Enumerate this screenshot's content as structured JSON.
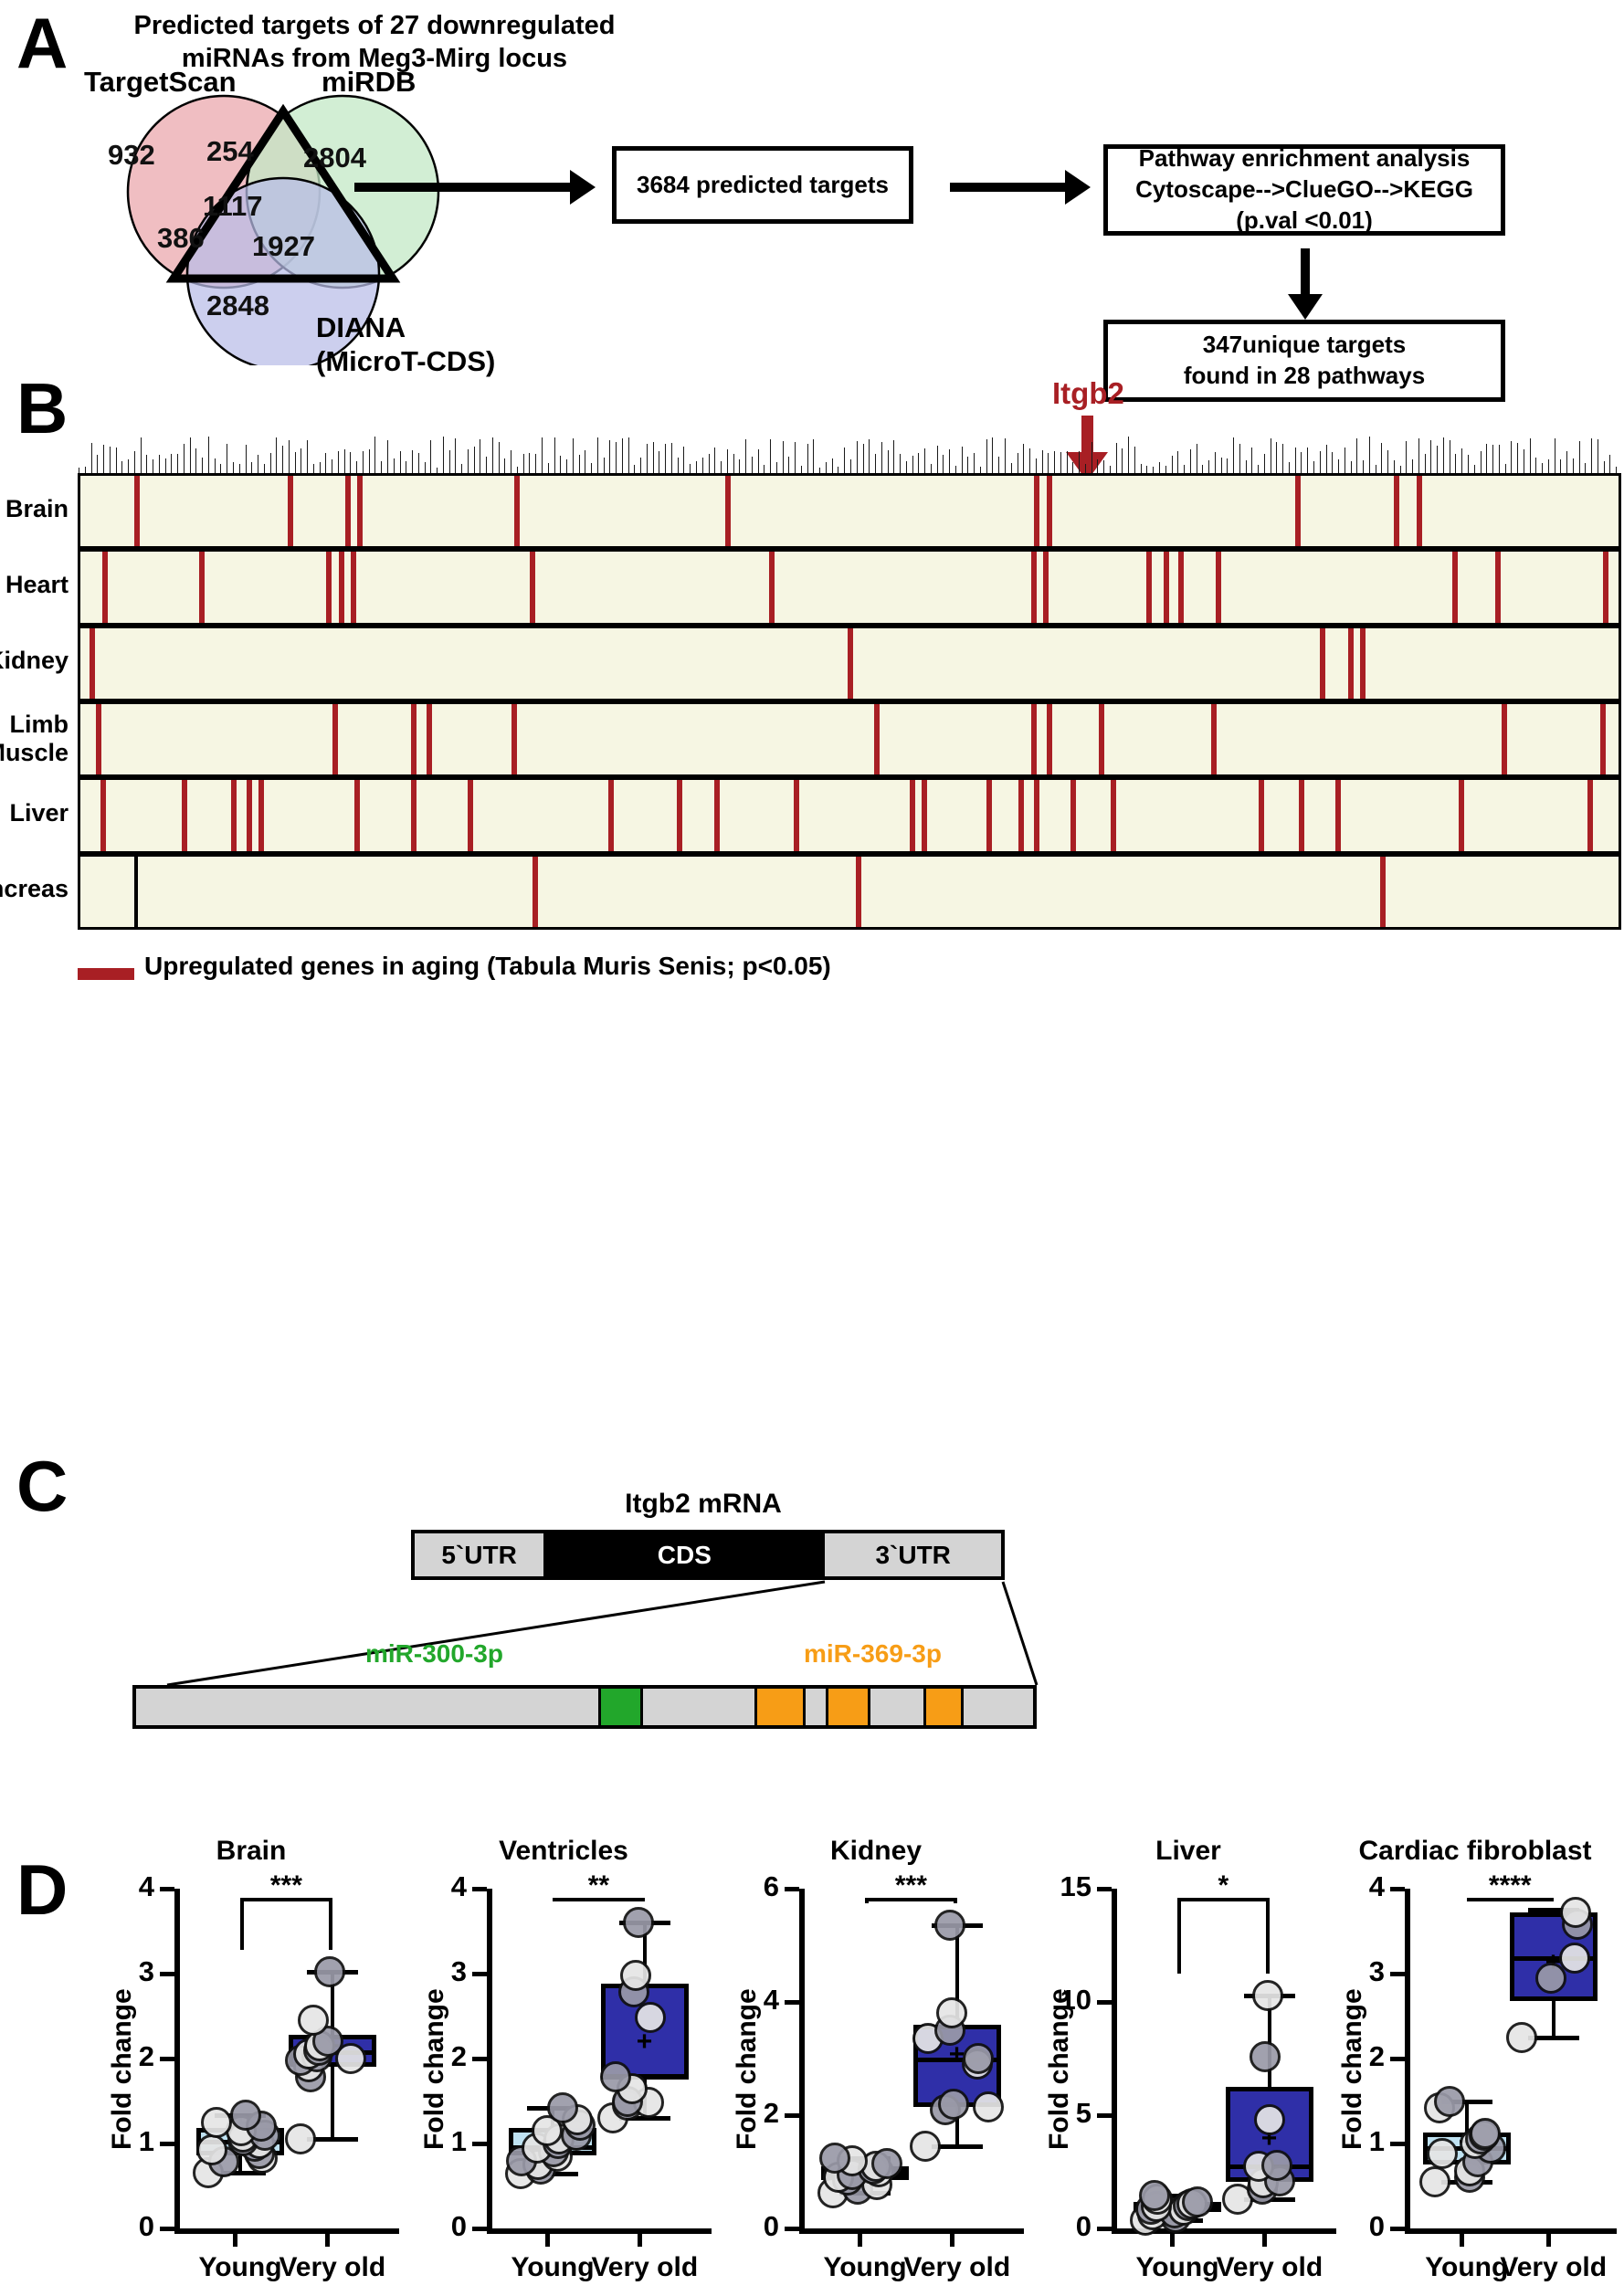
{
  "panelA": {
    "letter": "A",
    "title": "Predicted targets of 27 downregulated\nmiRNAs from Meg3-Mirg locus",
    "venn": {
      "sets": [
        {
          "name": "TargetScan",
          "color": "#efb8bd",
          "unique": "932"
        },
        {
          "name": "miRDB",
          "color": "#c3e8c6",
          "unique": "2804"
        },
        {
          "name": "DIANA\n(MicroT-CDS)",
          "color": "#b9bce8",
          "unique": "2848"
        }
      ],
      "overlaps": [
        {
          "label": "254",
          "sets": "TargetScan+miRDB"
        },
        {
          "label": "1117",
          "sets": "TargetScan+miRDB+DIANA"
        },
        {
          "label": "386",
          "sets": "TargetScan+DIANA"
        },
        {
          "label": "1927",
          "sets": "miRDB+DIANA"
        }
      ]
    },
    "box_targets": "3684 predicted targets",
    "box_pathway": "Pathway enrichment analysis\nCytoscape-->ClueGO-->KEGG\n(p.val <0.01)",
    "box_unique": "347unique targets\nfound in 28 pathways"
  },
  "panelB": {
    "letter": "B",
    "highlight_gene": "Itgb2",
    "tissues": [
      "Brain",
      "Heart",
      "Kidney",
      "Limb\nMuscle",
      "Liver",
      "Pancreas"
    ],
    "legend": "Upregulated genes in aging (Tabula Muris Senis; p<0.05)",
    "legend_color": "#a81f24",
    "grid_color": "#f6f6e3",
    "upregulated_positions": {
      "Brain": [
        3.5,
        13.5,
        17.2,
        18.0,
        28.2,
        41.9,
        62.0,
        62.8,
        79.0,
        85.4,
        86.9
      ],
      "Heart": [
        1.4,
        7.7,
        16.0,
        16.8,
        17.6,
        29.2,
        44.8,
        61.8,
        62.6,
        69.3,
        70.4,
        71.4,
        73.8,
        89.2,
        92.0,
        99.0
      ],
      "Kidney": [
        0.6,
        49.9,
        80.6,
        82.4,
        83.2
      ],
      "Limb\nMuscle": [
        1.0,
        16.4,
        21.5,
        22.5,
        28.0,
        51.6,
        61.8,
        62.8,
        66.2,
        73.5,
        92.4,
        98.8
      ],
      "Liver": [
        1.3,
        6.6,
        9.8,
        10.8,
        11.6,
        17.8,
        21.5,
        25.2,
        34.3,
        38.8,
        41.2,
        46.4,
        53.9,
        54.7,
        58.9,
        61.0,
        62.0,
        64.4,
        67.0,
        76.6,
        79.2,
        81.6,
        89.6,
        98.0
      ],
      "Pancreas": [
        29.4,
        50.4,
        84.5
      ]
    },
    "black_positions": {
      "Pancreas": [
        3.5
      ]
    }
  },
  "panelC": {
    "letter": "C",
    "mrna_title": "Itgb2 mRNA",
    "segments": [
      {
        "label": "5`UTR",
        "fill": "#d4d4d4",
        "text_color": "#000000"
      },
      {
        "label": "CDS",
        "fill": "#000000",
        "text_color": "#ffffff"
      },
      {
        "label": "3`UTR",
        "fill": "#d4d4d4",
        "text_color": "#000000"
      }
    ],
    "mir_sites": [
      {
        "name": "miR-300-3p",
        "color": "#22a72b"
      },
      {
        "name": "miR-369-3p",
        "color": "#f79d16"
      }
    ],
    "utr_track": [
      {
        "start": 0.0,
        "width": 51.5,
        "color": "#d4d4d4"
      },
      {
        "start": 51.5,
        "width": 5.0,
        "color": "#22a72b"
      },
      {
        "start": 56.5,
        "width": 12.4,
        "color": "#d4d4d4"
      },
      {
        "start": 68.9,
        "width": 5.7,
        "color": "#f79d16"
      },
      {
        "start": 74.6,
        "width": 2.3,
        "color": "#d4d4d4"
      },
      {
        "start": 76.9,
        "width": 5.0,
        "color": "#f79d16"
      },
      {
        "start": 81.9,
        "width": 5.9,
        "color": "#d4d4d4"
      },
      {
        "start": 87.8,
        "width": 4.5,
        "color": "#f79d16"
      },
      {
        "start": 92.3,
        "width": 7.7,
        "color": "#d4d4d4"
      }
    ]
  },
  "panelD": {
    "letter": "D",
    "ylabel": "Fold change",
    "xlabels": [
      "Young",
      "Very old"
    ],
    "colors": {
      "young_box": "#bfe2f2",
      "old_box": "#2f2fa8",
      "dot_fill": "#d9d9d9"
    }
  },
  "chart_data": [
    {
      "type": "box",
      "title": "Brain",
      "ylabel": "Fold change",
      "xlabel": "",
      "ylim": [
        0,
        4
      ],
      "yticks": [
        0,
        1,
        2,
        3,
        4
      ],
      "categories": [
        "Young",
        "Very old"
      ],
      "significance": "***",
      "series": [
        {
          "name": "Young",
          "box_color": "#bfe2f2",
          "min": 0.66,
          "q1": 0.86,
          "median": 1.02,
          "q3": 1.18,
          "max": 1.33,
          "mean": 1.0,
          "points": [
            0.66,
            0.78,
            0.83,
            0.88,
            0.93,
            0.97,
            1.0,
            1.03,
            1.07,
            1.1,
            1.15,
            1.2,
            1.25,
            1.33
          ]
        },
        {
          "name": "Very old",
          "box_color": "#2f2fa8",
          "min": 1.05,
          "q1": 1.9,
          "median": 2.07,
          "q3": 2.28,
          "max": 3.02,
          "mean": 2.13,
          "points": [
            1.05,
            1.78,
            1.9,
            1.98,
            2.0,
            2.02,
            2.05,
            2.1,
            2.15,
            2.2,
            2.45,
            3.02
          ]
        }
      ]
    },
    {
      "type": "box",
      "title": "Ventricles",
      "ylabel": "Fold change",
      "xlabel": "",
      "ylim": [
        0,
        4
      ],
      "yticks": [
        0,
        1,
        2,
        3,
        4
      ],
      "categories": [
        "Young",
        "Very old"
      ],
      "significance": "**",
      "series": [
        {
          "name": "Young",
          "box_color": "#bfe2f2",
          "min": 0.65,
          "q1": 0.86,
          "median": 0.96,
          "q3": 1.18,
          "max": 1.42,
          "mean": 1.02,
          "points": [
            0.65,
            0.7,
            0.75,
            0.8,
            0.85,
            0.9,
            0.95,
            1.0,
            1.05,
            1.1,
            1.15,
            1.22,
            1.28,
            1.42
          ]
        },
        {
          "name": "Very old",
          "box_color": "#2f2fa8",
          "min": 1.3,
          "q1": 1.75,
          "median": 1.8,
          "q3": 2.88,
          "max": 3.6,
          "mean": 2.18,
          "points": [
            1.3,
            1.45,
            1.48,
            1.5,
            1.65,
            1.78,
            2.48,
            2.78,
            2.98,
            3.6
          ]
        }
      ]
    },
    {
      "type": "box",
      "title": "Kidney",
      "ylabel": "Fold change",
      "xlabel": "",
      "ylim": [
        0,
        6
      ],
      "yticks": [
        0,
        2,
        4,
        6
      ],
      "categories": [
        "Young",
        "Very old"
      ],
      "significance": "***",
      "series": [
        {
          "name": "Young",
          "box_color": "#bfe2f2",
          "min": 0.63,
          "q1": 0.85,
          "median": 0.98,
          "q3": 1.1,
          "max": 1.25,
          "mean": 0.99,
          "points": [
            0.63,
            0.7,
            0.78,
            0.85,
            0.9,
            0.95,
            1.0,
            1.05,
            1.1,
            1.15,
            1.2,
            1.25
          ]
        },
        {
          "name": "Very old",
          "box_color": "#2f2fa8",
          "min": 1.45,
          "q1": 2.15,
          "median": 2.98,
          "q3": 3.6,
          "max": 5.35,
          "mean": 3.05,
          "points": [
            1.45,
            2.1,
            2.15,
            2.2,
            2.9,
            3.0,
            3.35,
            3.5,
            3.8,
            5.35
          ]
        }
      ]
    },
    {
      "type": "box",
      "title": "Liver",
      "ylabel": "Fold change",
      "xlabel": "",
      "ylim": [
        0,
        15
      ],
      "yticks": [
        0,
        5,
        10,
        15
      ],
      "categories": [
        "Young",
        "Very old"
      ],
      "significance": "*",
      "series": [
        {
          "name": "Young",
          "box_color": "#bfe2f2",
          "min": 0.35,
          "q1": 0.72,
          "median": 0.92,
          "q3": 1.15,
          "max": 1.45,
          "mean": 0.95,
          "points": [
            0.35,
            0.5,
            0.62,
            0.7,
            0.8,
            0.85,
            0.95,
            1.0,
            1.08,
            1.18,
            1.3,
            1.45
          ]
        },
        {
          "name": "Very old",
          "box_color": "#2f2fa8",
          "min": 1.3,
          "q1": 2.05,
          "median": 2.75,
          "q3": 6.25,
          "max": 10.3,
          "mean": 3.9,
          "points": [
            1.3,
            1.75,
            2.0,
            2.1,
            2.75,
            2.8,
            4.8,
            7.6,
            10.3
          ]
        }
      ]
    },
    {
      "type": "box",
      "title": "Cardiac fibroblast",
      "ylabel": "Fold change",
      "xlabel": "",
      "ylim": [
        0,
        4
      ],
      "yticks": [
        0,
        1,
        2,
        3,
        4
      ],
      "categories": [
        "Young",
        "Very old"
      ],
      "significance": "****",
      "series": [
        {
          "name": "Young",
          "box_color": "#bfe2f2",
          "min": 0.55,
          "q1": 0.75,
          "median": 0.95,
          "q3": 1.13,
          "max": 1.5,
          "mean": 1.0,
          "points": [
            0.55,
            0.6,
            0.68,
            0.78,
            0.88,
            0.95,
            1.0,
            1.05,
            1.1,
            1.12,
            1.42,
            1.5
          ]
        },
        {
          "name": "Very old",
          "box_color": "#2f2fa8",
          "min": 2.25,
          "q1": 2.68,
          "median": 3.18,
          "q3": 3.72,
          "max": 3.75,
          "mean": 3.12,
          "points": [
            2.25,
            2.95,
            3.18,
            3.58,
            3.72
          ]
        }
      ]
    }
  ]
}
